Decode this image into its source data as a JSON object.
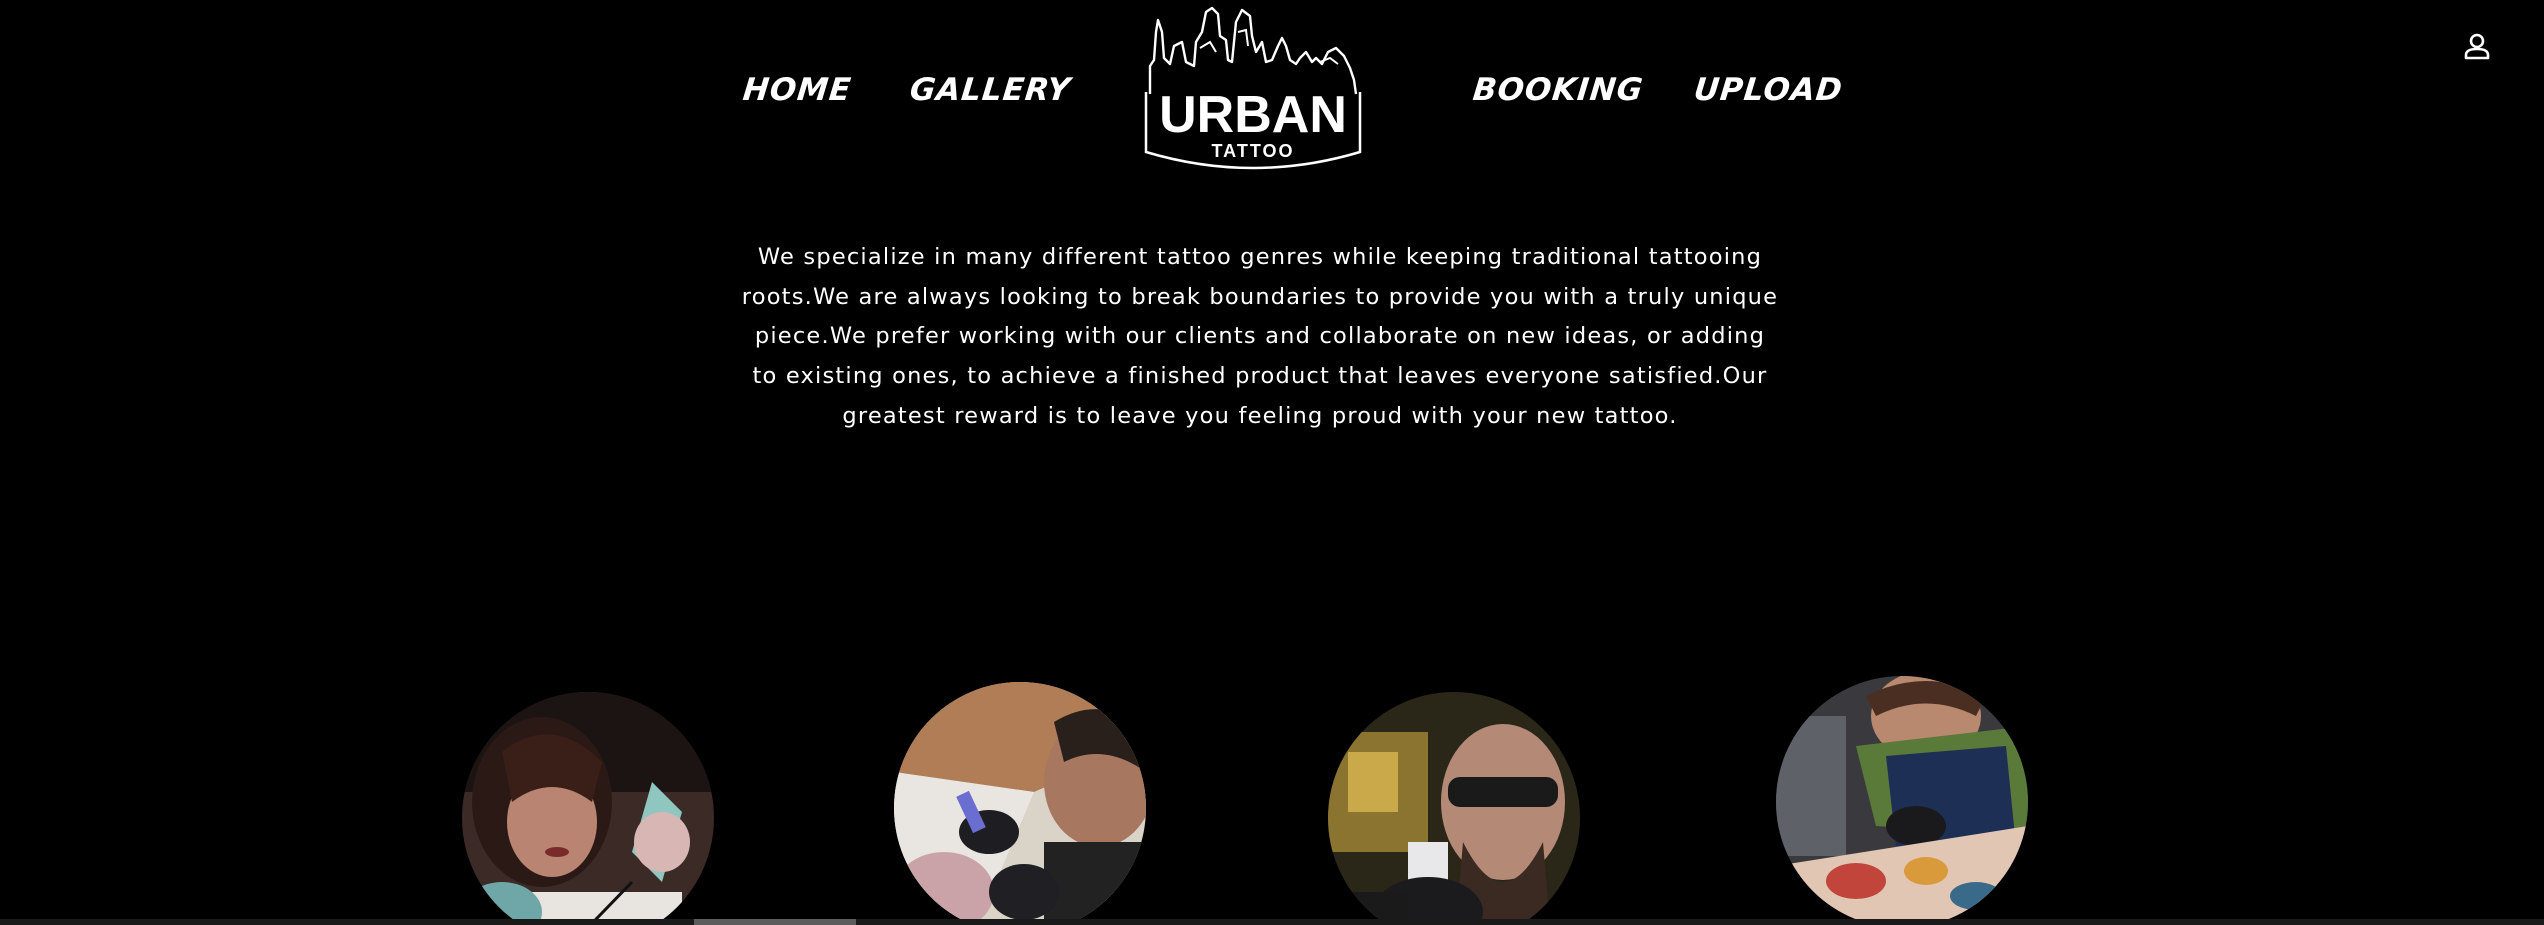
{
  "nav": {
    "home": "HOME",
    "gallery": "GALLERY",
    "booking": "BOOKING",
    "upload": "UPLOAD"
  },
  "logo": {
    "brand": "URBAN",
    "sub": "TATTOO"
  },
  "intro": {
    "text": "We specialize in many different tattoo genres while keeping traditional tattooing roots.We are always looking to break boundaries to provide you with a truly unique piece.We prefer working with our clients and collaborate on new ideas, or adding to existing ones, to achieve a finished product that leaves everyone satisfied.Our greatest reward is to leave you feeling proud with your new tattoo."
  },
  "icons": {
    "account": "user-account-icon"
  },
  "colors": {
    "background": "#000000",
    "text": "#ffffff"
  }
}
